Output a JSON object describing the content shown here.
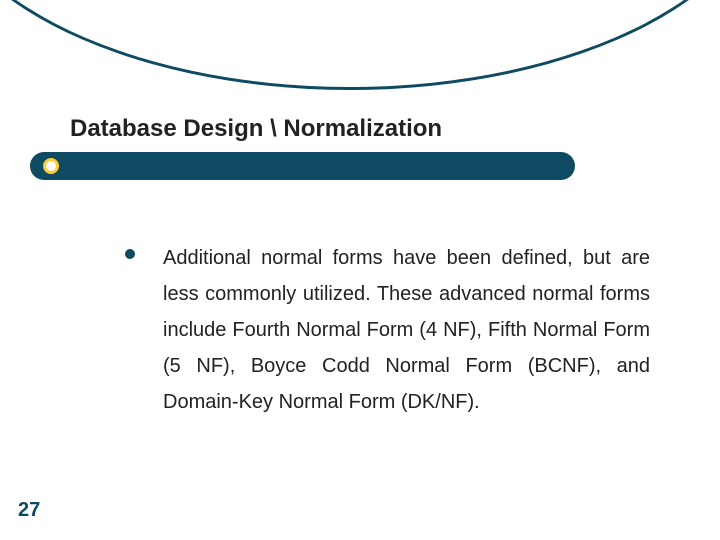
{
  "title": "Database Design \\ Normalization",
  "bullet": {
    "text": "Additional normal forms have been defined, but are less commonly utilized. These advanced normal forms include Fourth Normal Form (4 NF), Fifth Normal Form (5 NF), Boyce Codd Normal Form (BCNF), and Domain-Key Normal Form (DK/NF)."
  },
  "page_number": "27",
  "colors": {
    "brand": "#0f4a63",
    "accent": "#ffcc33"
  }
}
